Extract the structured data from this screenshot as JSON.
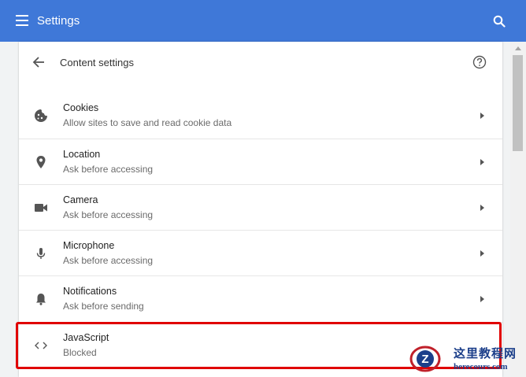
{
  "topbar": {
    "title": "Settings",
    "menu_icon": "hamburger-menu-icon",
    "search_icon": "search-icon",
    "color": "#3f78d8"
  },
  "header": {
    "title": "Content settings",
    "back_icon": "arrow-left-icon",
    "help_icon": "help-circle-icon"
  },
  "items": [
    {
      "label": "Cookies",
      "sub": "Allow sites to save and read cookie data",
      "icon": "cookie-icon"
    },
    {
      "label": "Location",
      "sub": "Ask before accessing",
      "icon": "location-pin-icon"
    },
    {
      "label": "Camera",
      "sub": "Ask before accessing",
      "icon": "video-camera-icon"
    },
    {
      "label": "Microphone",
      "sub": "Ask before accessing",
      "icon": "microphone-icon"
    },
    {
      "label": "Notifications",
      "sub": "Ask before sending",
      "icon": "bell-icon"
    },
    {
      "label": "JavaScript",
      "sub": "Blocked",
      "icon": "code-brackets-icon"
    }
  ],
  "highlight_color": "#e00000",
  "watermark": {
    "text_cn": "这里教程网",
    "url": "herecours.com"
  }
}
